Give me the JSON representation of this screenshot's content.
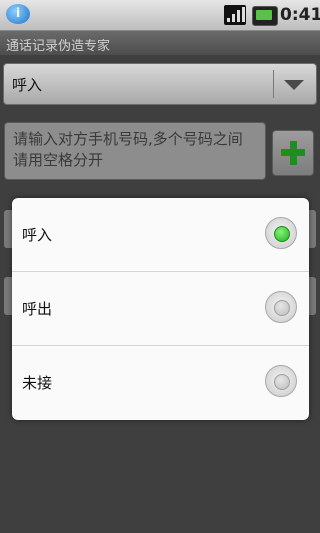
{
  "status_bar": {
    "time": "0:41",
    "app_icon_letter": "i"
  },
  "window_title": "通话记录伪造专家",
  "call_type_spinner": {
    "selected": "呼入"
  },
  "phone_input": {
    "placeholder": "请输入对方手机号码,多个号码之间请用空格分开"
  },
  "dialog": {
    "options": [
      {
        "label": "呼入",
        "checked": true
      },
      {
        "label": "呼出",
        "checked": false
      },
      {
        "label": "未接",
        "checked": false
      }
    ]
  },
  "colors": {
    "radio_checked": "#1fb51f",
    "add_icon": "#1e8f1e",
    "dialog_bg": "#fafafa"
  }
}
